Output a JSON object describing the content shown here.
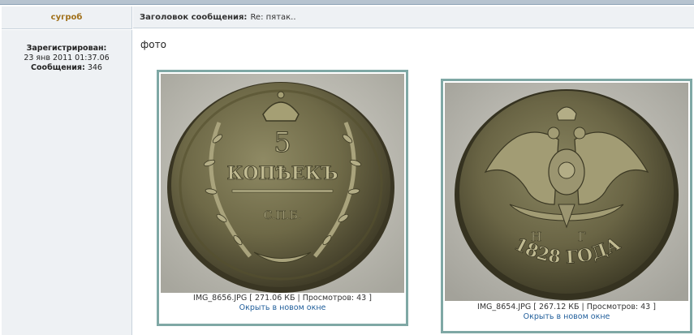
{
  "post": {
    "author": "сугроб",
    "subject_label": "Заголовок сообщения:",
    "subject": "Re: пятак..",
    "registered_label": "Зарегистрирован:",
    "registered_date": "23 янв 2011 01:37.06",
    "messages_label": "Сообщения:",
    "messages_count": "346",
    "body_text": "фото"
  },
  "attachments": [
    {
      "file_name": "IMG_8656.JPG",
      "size": "271.06 КБ",
      "views_label": "Просмотров:",
      "views": "43",
      "caption": "IMG_8656.JPG [ 271.06 КБ | Просмотров: 43 ]",
      "open_link": "Окрыть в новом окне",
      "coin": {
        "denomination": "5",
        "word": "КОПѢЕКЪ",
        "mint": "С.П.Б."
      }
    },
    {
      "file_name": "IMG_8654.JPG",
      "size": "267.12 КБ",
      "views_label": "Просмотров:",
      "views": "43",
      "caption": "IMG_8654.JPG [ 267.12 КБ | Просмотров: 43 ]",
      "open_link": "Окрыть в новом окне",
      "coin": {
        "letters": "Н Г",
        "year_text": "1828 ГОДА"
      }
    }
  ],
  "colors": {
    "header_bg": "#eef1f4",
    "author": "#a0701a",
    "link": "#1f5d9a",
    "attachment_border": "#7fa8a5"
  }
}
